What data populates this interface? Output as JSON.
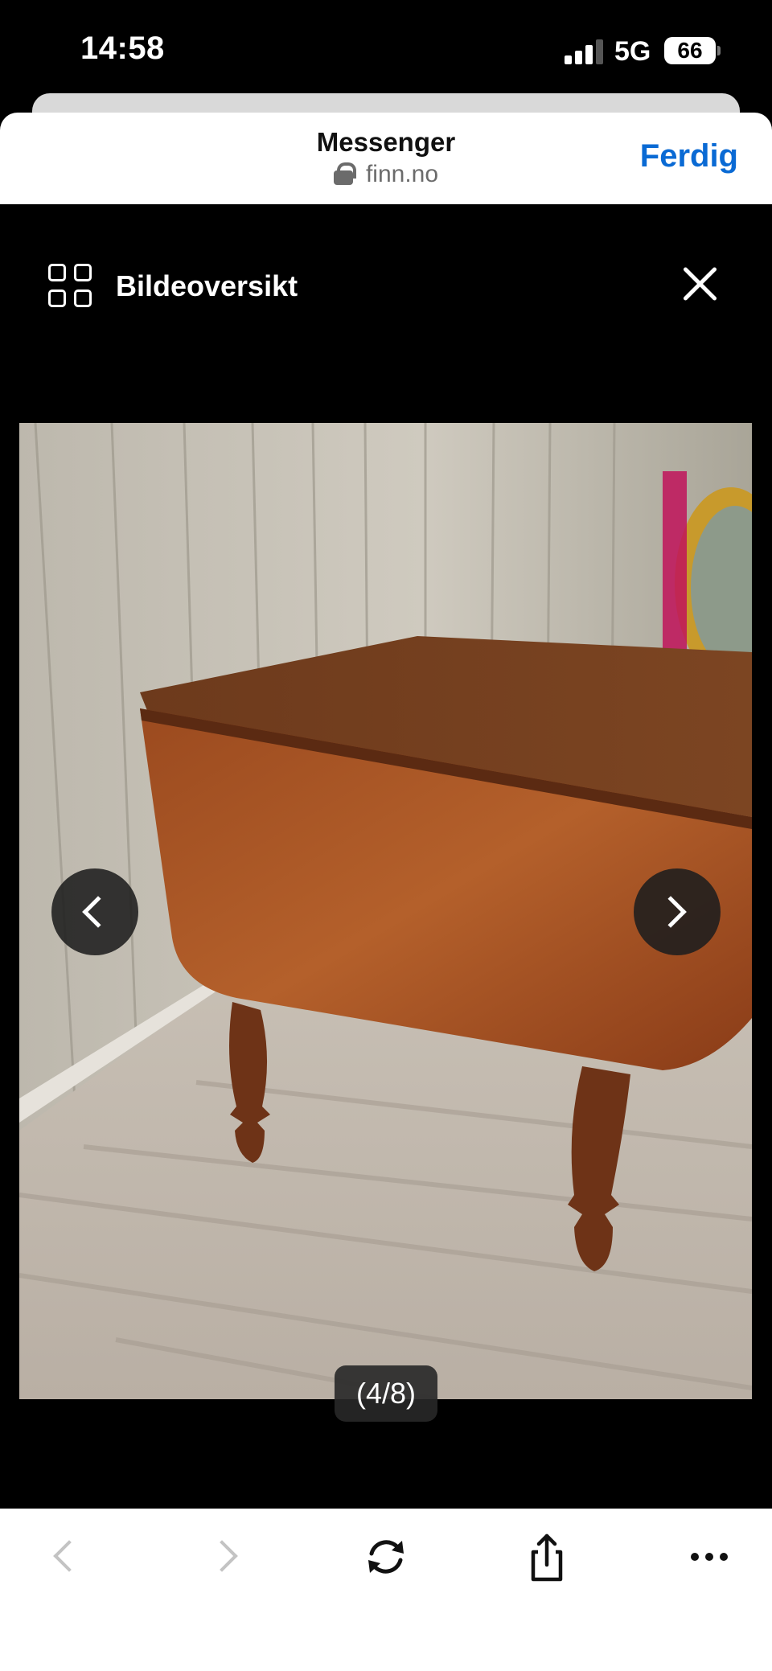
{
  "status_bar": {
    "time": "14:58",
    "network": "5G",
    "battery": "66"
  },
  "browser": {
    "title": "Messenger",
    "domain": "finn.no",
    "done_label": "Ferdig"
  },
  "gallery": {
    "overview_label": "Bildeoversikt",
    "counter": "(4/8)"
  },
  "icons": {
    "signal": "signal-icon",
    "lock": "lock-icon",
    "grid": "grid-icon",
    "close": "close-icon",
    "prev": "chevron-left-icon",
    "next": "chevron-right-icon",
    "reload": "reload-icon",
    "share": "share-icon",
    "more": "more-icon"
  },
  "colors": {
    "accent": "#0a6ad4",
    "background": "#000000"
  }
}
